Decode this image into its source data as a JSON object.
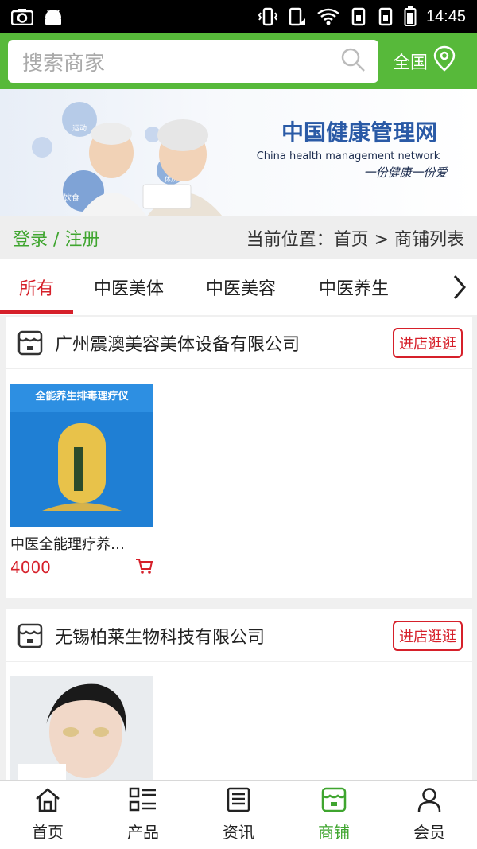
{
  "statusbar": {
    "time": "14:45"
  },
  "search": {
    "placeholder": "搜索商家"
  },
  "region": {
    "label": "全国"
  },
  "banner": {
    "logo_title": "中国健康管理网",
    "logo_subtitle": "China health management network",
    "slogan": "一份健康一份爱",
    "bubble_1": "运动",
    "bubble_2": "饮食",
    "bubble_3": "体质"
  },
  "locbar": {
    "login": "登录 / 注册",
    "breadcrumb": "当前位置：首页 > 商铺列表"
  },
  "tabs": [
    {
      "label": "所有"
    },
    {
      "label": "中医美体"
    },
    {
      "label": "中医美容"
    },
    {
      "label": "中医养生"
    }
  ],
  "shops": [
    {
      "name": "广州震澳美容美体设备有限公司",
      "button": "进店逛逛",
      "product": {
        "name": "中医全能理疗养…",
        "price": "4000",
        "image_text": "全能养生排毒理疗仪"
      }
    },
    {
      "name": "无锡柏莱生物科技有限公司",
      "button": "进店逛逛"
    }
  ],
  "bottomnav": [
    {
      "label": "首页",
      "icon": "home-icon"
    },
    {
      "label": "产品",
      "icon": "list-icon"
    },
    {
      "label": "资讯",
      "icon": "news-icon"
    },
    {
      "label": "商铺",
      "icon": "shop-icon"
    },
    {
      "label": "会员",
      "icon": "user-icon"
    }
  ],
  "colors": {
    "brand_green": "#57b93a",
    "accent_red": "#d6202a"
  }
}
